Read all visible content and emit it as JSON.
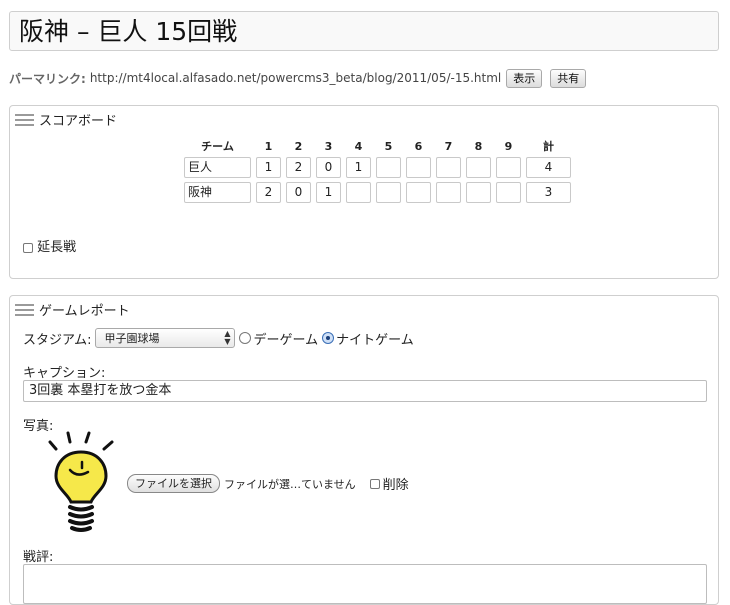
{
  "entry": {
    "title": "阪神 – 巨人 15回戦"
  },
  "permalink": {
    "label": "パーマリンク:",
    "url": "http://mt4local.alfasado.net/powercms3_beta/blog/2011/05/-15.html",
    "view_button": "表示",
    "share_button": "共有"
  },
  "scoreboard": {
    "heading": "スコアボード",
    "columns": [
      "チーム",
      "1",
      "2",
      "3",
      "4",
      "5",
      "6",
      "7",
      "8",
      "9",
      "計"
    ],
    "rows": [
      {
        "team": "巨人",
        "innings": [
          "1",
          "2",
          "0",
          "1",
          "",
          "",
          "",
          "",
          ""
        ],
        "total": "4"
      },
      {
        "team": "阪神",
        "innings": [
          "2",
          "0",
          "1",
          "",
          "",
          "",
          "",
          "",
          ""
        ],
        "total": "3"
      }
    ],
    "extra_innings_label": "延長戦"
  },
  "report": {
    "heading": "ゲームレポート",
    "stadium_label": "スタジアム:",
    "stadium_value": "甲子園球場",
    "day_game_label": "デーゲーム",
    "night_game_label": "ナイトゲーム",
    "caption_label": "キャプション:",
    "caption_value": "3回裏 本塁打を放つ金本",
    "photo_label": "写真:",
    "file_button": "ファイルを選択",
    "file_status": "ファイルが選…ていません",
    "delete_label": "削除",
    "review_label": "戦評:"
  },
  "colors": {
    "bulb": "#f6e84a",
    "radio_selected": "#1b3f7a"
  },
  "icons": {
    "panel_handle": "drag-handle-icon",
    "photo": "lightbulb-icon"
  }
}
